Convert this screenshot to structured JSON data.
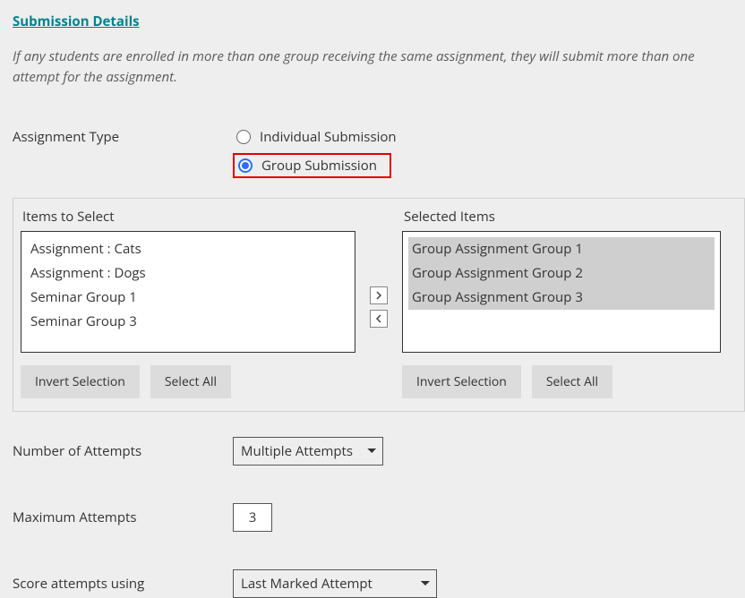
{
  "section_title": "Submission Details",
  "info_text": "If any students are enrolled in more than one group receiving the same assignment, they will submit more than one attempt for the assignment.",
  "assignment_type": {
    "label": "Assignment Type",
    "options": [
      {
        "label": "Individual Submission",
        "checked": false
      },
      {
        "label": "Group Submission",
        "checked": true,
        "highlighted": true
      }
    ]
  },
  "dual_list": {
    "left": {
      "header": "Items to Select",
      "items": [
        "Assignment : Cats",
        "Assignment : Dogs",
        "Seminar Group 1",
        "Seminar Group 3"
      ],
      "invert_label": "Invert Selection",
      "select_all_label": "Select All"
    },
    "right": {
      "header": "Selected Items",
      "items": [
        "Group Assignment Group 1",
        "Group Assignment Group 2",
        "Group Assignment Group 3"
      ],
      "invert_label": "Invert Selection",
      "select_all_label": "Select All"
    }
  },
  "attempts": {
    "label": "Number of Attempts",
    "value": "Multiple Attempts"
  },
  "max_attempts": {
    "label": "Maximum Attempts",
    "value": "3"
  },
  "score_using": {
    "label": "Score attempts using",
    "value": "Last Marked Attempt"
  }
}
